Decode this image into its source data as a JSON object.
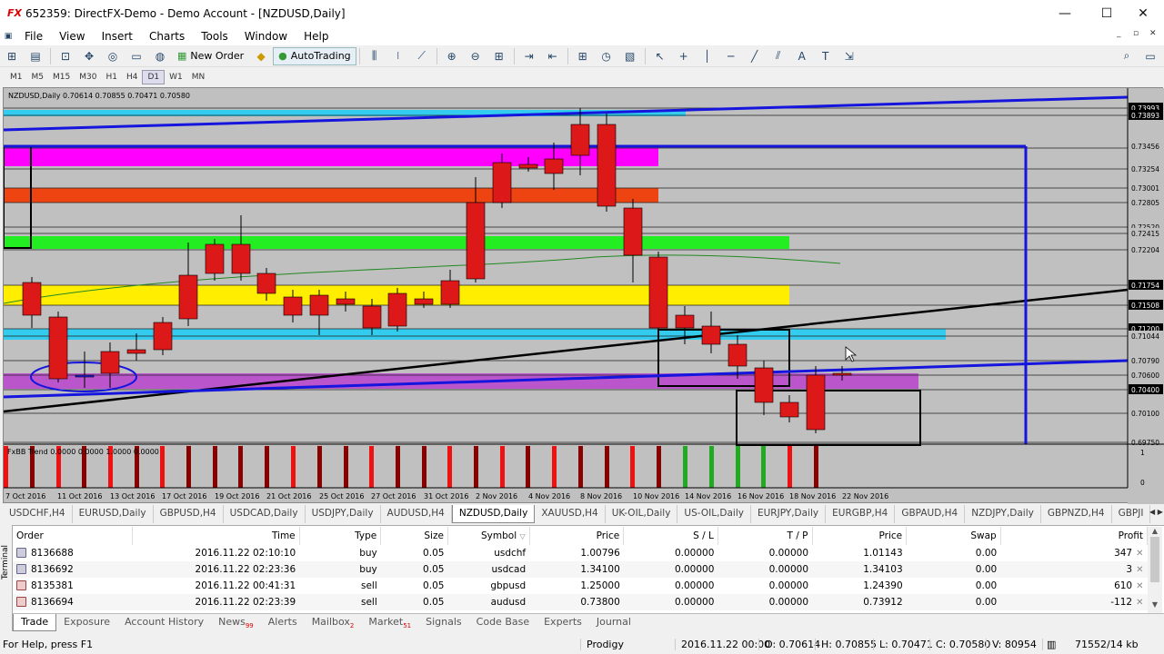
{
  "window": {
    "title": "652359: DirectFX-Demo - Demo Account - [NZDUSD,Daily]",
    "logo": "FX",
    "minimize": "—",
    "maximize": "☐",
    "close": "✕"
  },
  "menu": [
    "File",
    "View",
    "Insert",
    "Charts",
    "Tools",
    "Window",
    "Help"
  ],
  "toolbar": {
    "new_order": "New Order",
    "autotrading": "AutoTrading"
  },
  "timeframes": [
    "M1",
    "M5",
    "M15",
    "M30",
    "H1",
    "H4",
    "D1",
    "W1",
    "MN"
  ],
  "active_timeframe": "D1",
  "chart": {
    "header": "NZDUSD,Daily  0.70614 0.70855 0.70471 0.70580",
    "indicator_label": "FxBB Trend 0.0000 0.0000 1.0000 0.0000",
    "price_labels": [
      "0.73993",
      "0.73893",
      "0.73456",
      "0.73254",
      "0.73001",
      "0.72805",
      "0.72520",
      "0.72415",
      "0.72204",
      "0.71754",
      "0.71508",
      "0.71200",
      "0.71044",
      "0.70790",
      "0.70600",
      "0.70400",
      "0.70100",
      "0.69750"
    ],
    "indicator_scale": [
      "1",
      "0"
    ],
    "dates": [
      "7 Oct 2016",
      "11 Oct 2016",
      "13 Oct 2016",
      "17 Oct 2016",
      "19 Oct 2016",
      "21 Oct 2016",
      "25 Oct 2016",
      "27 Oct 2016",
      "31 Oct 2016",
      "2 Nov 2016",
      "4 Nov 2016",
      "8 Nov 2016",
      "10 Nov 2016",
      "14 Nov 2016",
      "16 Nov 2016",
      "18 Nov 2016",
      "22 Nov 2016"
    ]
  },
  "symbol_tabs": [
    "USDCHF,H4",
    "EURUSD,Daily",
    "GBPUSD,H4",
    "USDCAD,Daily",
    "USDJPY,Daily",
    "AUDUSD,H4",
    "NZDUSD,Daily",
    "XAUUSD,H4",
    "UK-OIL,Daily",
    "US-OIL,Daily",
    "EURJPY,Daily",
    "EURGBP,H4",
    "GBPAUD,H4",
    "NZDJPY,Daily",
    "GBPNZD,H4",
    "GBPJI"
  ],
  "active_symbol_tab": "NZDUSD,Daily",
  "terminal": {
    "side_label": "Terminal",
    "columns": [
      "Order",
      "Time",
      "Type",
      "Size",
      "Symbol",
      "Price",
      "S / L",
      "T / P",
      "Price",
      "Swap",
      "Profit"
    ],
    "rows": [
      {
        "order": "8136688",
        "time": "2016.11.22 02:10:10",
        "type": "buy",
        "size": "0.05",
        "symbol": "usdchf",
        "price": "1.00796",
        "sl": "0.00000",
        "tp": "0.00000",
        "cur": "1.01143",
        "swap": "0.00",
        "profit": "347"
      },
      {
        "order": "8136692",
        "time": "2016.11.22 02:23:36",
        "type": "buy",
        "size": "0.05",
        "symbol": "usdcad",
        "price": "1.34100",
        "sl": "0.00000",
        "tp": "0.00000",
        "cur": "1.34103",
        "swap": "0.00",
        "profit": "3"
      },
      {
        "order": "8135381",
        "time": "2016.11.22 00:41:31",
        "type": "sell",
        "size": "0.05",
        "symbol": "gbpusd",
        "price": "1.25000",
        "sl": "0.00000",
        "tp": "0.00000",
        "cur": "1.24390",
        "swap": "0.00",
        "profit": "610"
      },
      {
        "order": "8136694",
        "time": "2016.11.22 02:23:39",
        "type": "sell",
        "size": "0.05",
        "symbol": "audusd",
        "price": "0.73800",
        "sl": "0.00000",
        "tp": "0.00000",
        "cur": "0.73912",
        "swap": "0.00",
        "profit": "-112"
      }
    ],
    "tabs": [
      {
        "label": "Trade",
        "badge": ""
      },
      {
        "label": "Exposure",
        "badge": ""
      },
      {
        "label": "Account History",
        "badge": ""
      },
      {
        "label": "News",
        "badge": "99"
      },
      {
        "label": "Alerts",
        "badge": ""
      },
      {
        "label": "Mailbox",
        "badge": "2"
      },
      {
        "label": "Market",
        "badge": "51"
      },
      {
        "label": "Signals",
        "badge": ""
      },
      {
        "label": "Code Base",
        "badge": ""
      },
      {
        "label": "Experts",
        "badge": ""
      },
      {
        "label": "Journal",
        "badge": ""
      }
    ]
  },
  "status": {
    "help": "For Help, press F1",
    "profile": "Prodigy",
    "datetime": "2016.11.22 00:00",
    "open": "O: 0.70614",
    "high": "H: 0.70855",
    "low": "L: 0.70471",
    "close": "C: 0.70580",
    "volume": "V: 80954",
    "traffic": "71552/14 kb"
  }
}
